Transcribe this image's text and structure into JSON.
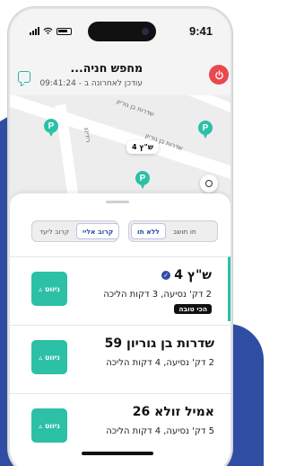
{
  "status_bar": {
    "time": "9:41"
  },
  "header": {
    "title": "מחפש חניה...",
    "subtitle": "עודכן לאחרונה ב - 09:41:24",
    "colors": {
      "power": "#e9484c",
      "accent": "#2cc0a6"
    }
  },
  "map": {
    "streets": [
      "שדרות בן גוריון",
      "שדרות בן גוריון",
      "רידינג"
    ],
    "selected_pin_label": "ש\"ץ 4",
    "pin_symbol": "P"
  },
  "filters": {
    "sort": {
      "options": [
        "קרוב ליעד",
        "קרוב אליי"
      ],
      "selected": "קרוב אליי"
    },
    "price": {
      "options": [
        "תו תושב",
        "ללא תו"
      ],
      "selected": "ללא תו"
    }
  },
  "parking_list": [
    {
      "name": "ש\"ץ 4",
      "description": "2 דק' נסיעה, 3 דקות הליכה",
      "badge": "הכי טובה",
      "verified": true,
      "button_label": "ניווט"
    },
    {
      "name": "שדרות בן גוריון 59",
      "description": "2 דק' נסיעה, 4 דקות הליכה",
      "badge": "",
      "verified": false,
      "button_label": "ניווט"
    },
    {
      "name": "אמיל זולא 26",
      "description": "5 דק' נסיעה, 4 דקות הליכה",
      "badge": "",
      "verified": false,
      "button_label": "ניווט"
    }
  ]
}
